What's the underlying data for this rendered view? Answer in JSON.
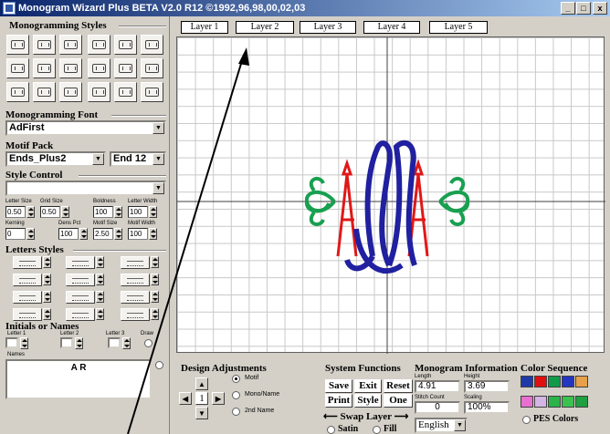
{
  "window": {
    "title": "Monogram Wizard Plus BETA V2.0 R12 ©1992,96,98,00,02,03",
    "minimize": "_",
    "maximize": "□",
    "close": "x"
  },
  "left": {
    "styles_title": "Monogramming Styles",
    "font_title": "Monogramming Font",
    "font_value": "AdFirst",
    "motif_title": "Motif Pack",
    "motif_value": "Ends_Plus2",
    "motif_end": "End  12",
    "style_control_title": "Style Control",
    "style_control_value": "",
    "labels": {
      "letter_size": "Letter Size",
      "grid_size": "Grid Size",
      "boldness": "Boldness",
      "letter_width": "Letter Width",
      "kerning": "Kerning",
      "dens_pct": "Dens Pct",
      "motif_size": "Motif Size",
      "motif_width": "Motif Width"
    },
    "values": {
      "letter_size": "0.50",
      "grid_size": "0.50",
      "boldness": "100",
      "letter_width": "100",
      "kerning": "0",
      "dens_pct": "100",
      "motif_size": "2.50",
      "motif_width": "100"
    },
    "letters_title": "Letters Styles",
    "initials_title": "Initials or Names",
    "letter1": "Letter 1",
    "letter2": "Letter 2",
    "letter3": "Letter 3",
    "draw": "Draw",
    "names": "Names",
    "names_value": "A R"
  },
  "tabs": [
    "Layer 1",
    "Layer 2",
    "Layer 3",
    "Layer 4",
    "Layer 5"
  ],
  "bottom": {
    "design_title": "Design Adjustments",
    "motif": "Motif",
    "mono_name": "Mono/Name",
    "second_name": "2nd Name",
    "step": "1",
    "system_title": "System Functions",
    "save": "Save",
    "exit": "Exit",
    "reset": "Reset",
    "print": "Print",
    "style": "Style",
    "one": "One",
    "swap": "Swap Layer",
    "satin": "Satin",
    "fill": "Fill",
    "info_title": "Monogram Information",
    "length_label": "Length",
    "height_label": "Height",
    "length": "4.91",
    "height": "3.69",
    "stitch_label": "Stitch Count",
    "scaling_label": "Scaling",
    "stitch": "0",
    "scaling": "100%",
    "language": "English",
    "color_title": "Color Sequence",
    "pes": "PES Colors",
    "colors_row1": [
      "#1f3aa8",
      "#e01010",
      "#129a4b",
      "#2436c0",
      "#e6a14a"
    ],
    "colors_row2": [
      "#e870d0",
      "#d4b6e6",
      "#2bb34a",
      "#3bc24e",
      "#20a040"
    ]
  }
}
